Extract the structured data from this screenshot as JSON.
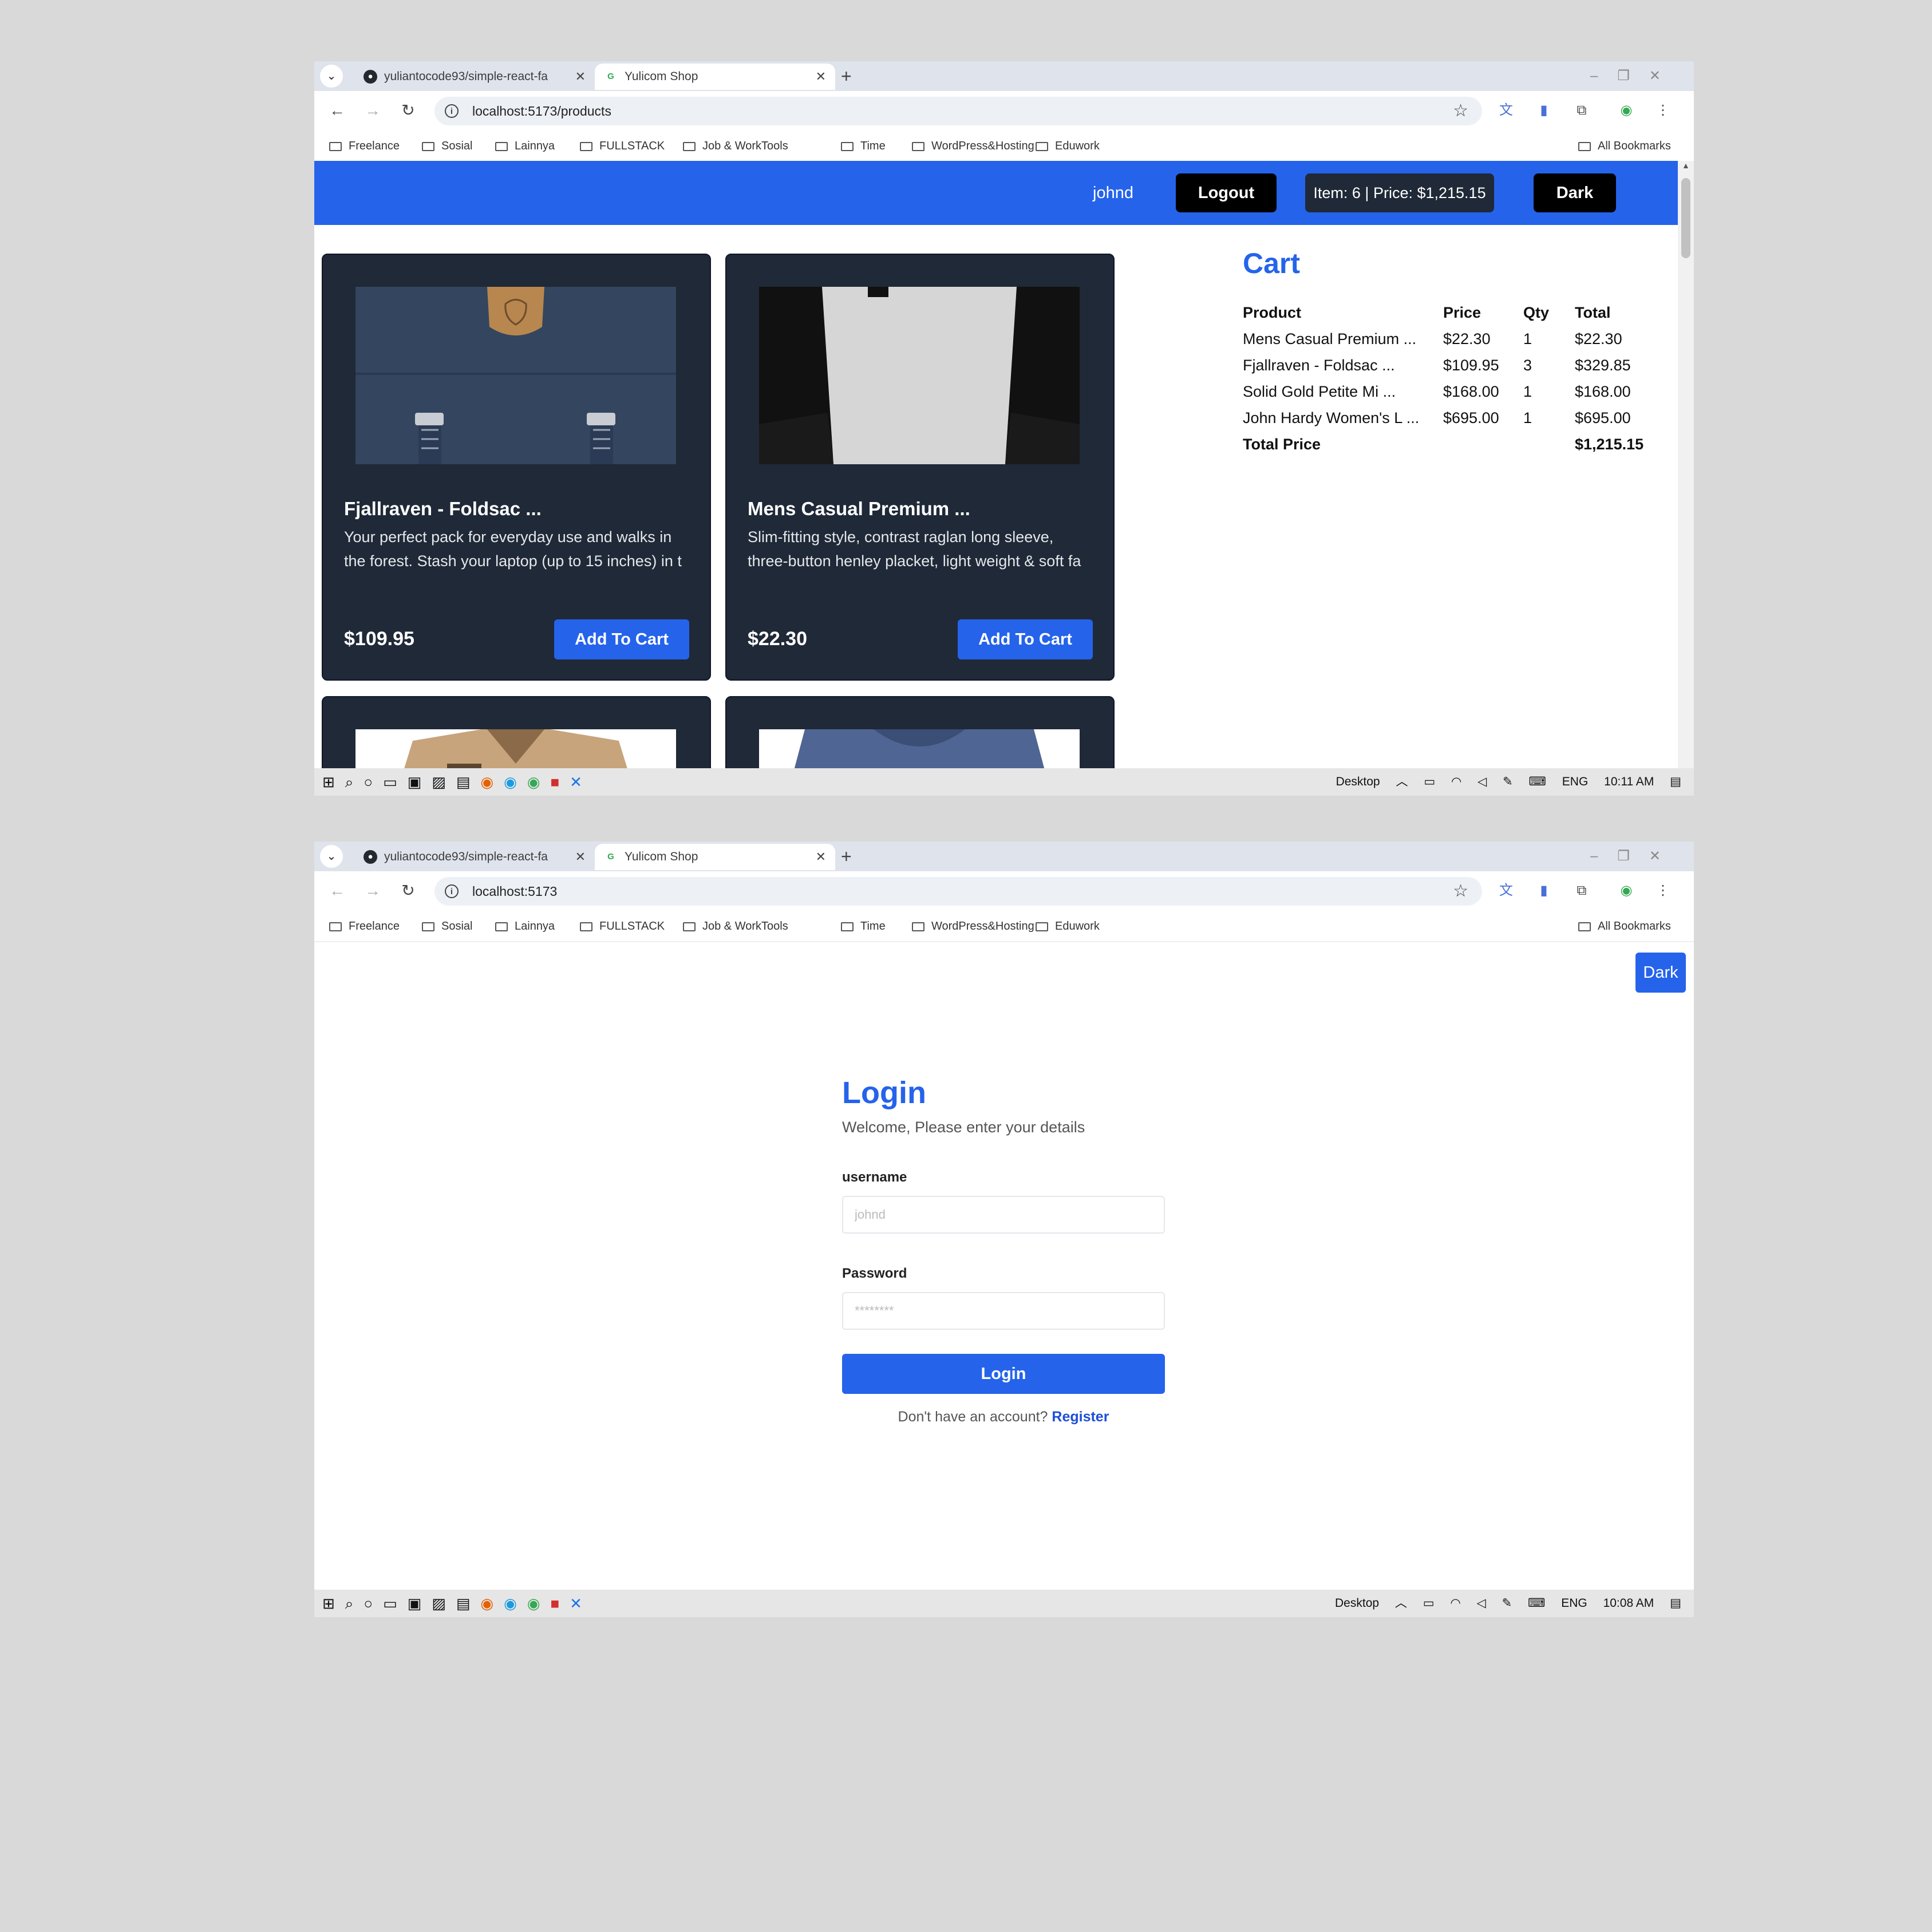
{
  "shot1": {
    "tabs": [
      {
        "title": "yuliantocode93/simple-react-fa",
        "active": false
      },
      {
        "title": "Yulicom Shop",
        "active": true
      }
    ],
    "url": "localhost:5173/products",
    "bookmarks": [
      "Freelance",
      "Sosial",
      "Lainnya",
      "FULLSTACK",
      "Job & WorkTools",
      "Time",
      "WordPress&Hosting",
      "Eduwork"
    ],
    "all_bookmarks": "All Bookmarks",
    "navbar": {
      "user": "johnd",
      "logout": "Logout",
      "cart_summary": "Item: 6 | Price: $1,215.15",
      "theme": "Dark"
    },
    "products": [
      {
        "name": "Fjallraven - Foldsac ...",
        "description": "Your perfect pack for everyday use and walks in the forest. Stash your laptop (up to 15 inches) in t",
        "price": "$109.95",
        "button": "Add To Cart"
      },
      {
        "name": "Mens Casual Premium ...",
        "description": "Slim-fitting style, contrast raglan long sleeve, three-button henley placket, light weight & soft fa",
        "price": "$22.30",
        "button": "Add To Cart"
      }
    ],
    "cart": {
      "title": "Cart",
      "headers": [
        "Product",
        "Price",
        "Qty",
        "Total"
      ],
      "rows": [
        [
          "Mens Casual Premium ...",
          "$22.30",
          "1",
          "$22.30"
        ],
        [
          "Fjallraven - Foldsac ...",
          "$109.95",
          "3",
          "$329.85"
        ],
        [
          "Solid Gold Petite Mi ...",
          "$168.00",
          "1",
          "$168.00"
        ],
        [
          "John Hardy Women's L ...",
          "$695.00",
          "1",
          "$695.00"
        ]
      ],
      "total_label": "Total Price",
      "total_value": "$1,215.15"
    },
    "taskbar": {
      "desktop": "Desktop",
      "lang": "ENG",
      "time": "10:11 AM"
    }
  },
  "shot2": {
    "tabs": [
      {
        "title": "yuliantocode93/simple-react-fa",
        "active": false
      },
      {
        "title": "Yulicom Shop",
        "active": true
      }
    ],
    "url": "localhost:5173",
    "theme": "Dark",
    "login": {
      "title": "Login",
      "subtitle": "Welcome, Please enter your details",
      "username_label": "username",
      "username_placeholder": "johnd",
      "password_label": "Password",
      "password_placeholder": "********",
      "button": "Login",
      "no_account": "Don't have an account?",
      "register": "Register"
    },
    "taskbar": {
      "desktop": "Desktop",
      "lang": "ENG",
      "time": "10:08 AM"
    }
  },
  "colors": {
    "brand": "#2563eb",
    "card": "#1f2937"
  }
}
